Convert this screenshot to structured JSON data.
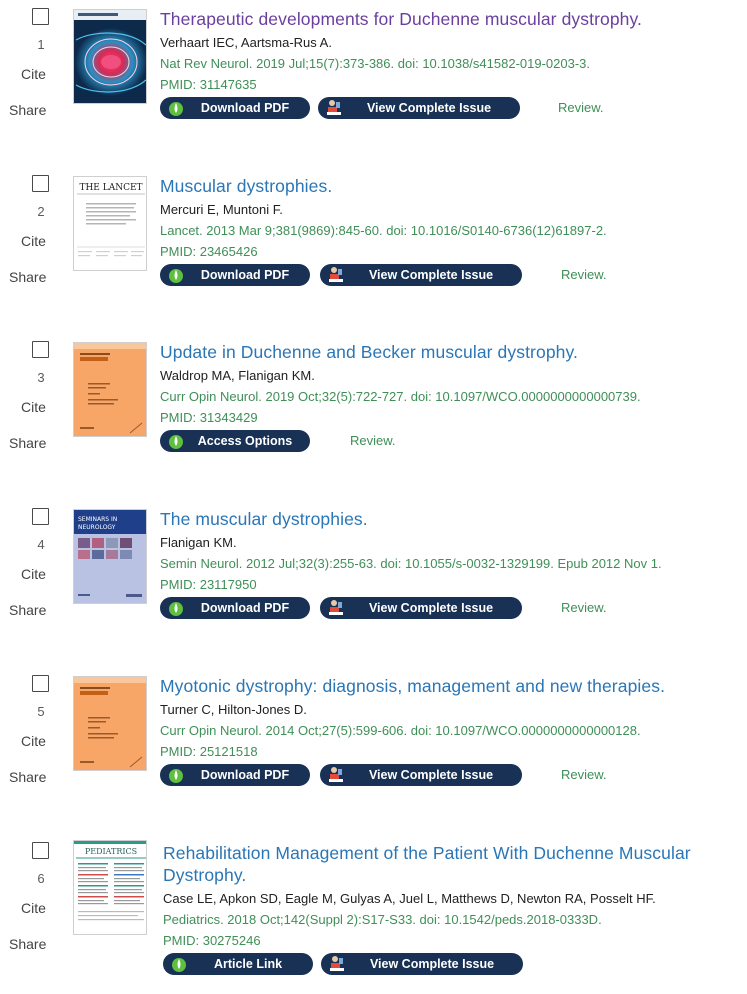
{
  "results": [
    {
      "number": "1",
      "title": "Therapeutic developments for Duchenne muscular dystrophy.",
      "authors": "Verhaart IEC, Aartsma-Rus A.",
      "citation": "Nat Rev Neurol. 2019 Jul;15(7):373-386. doi: 10.1038/s41582-019-0203-3.",
      "pmid": "PMID: 31147635",
      "buttons": [
        "Download PDF",
        "View Complete Issue"
      ],
      "tag": "Review.",
      "journal_cover": "nature reviews neurology"
    },
    {
      "number": "2",
      "title": "Muscular dystrophies.",
      "authors": "Mercuri E, Muntoni F.",
      "citation": "Lancet. 2013 Mar 9;381(9869):845-60. doi: 10.1016/S0140-6736(12)61897-2.",
      "pmid": "PMID: 23465426",
      "buttons": [
        "Download PDF",
        "View Complete Issue"
      ],
      "tag": "Review.",
      "journal_cover": "THE LANCET"
    },
    {
      "number": "3",
      "title": "Update in Duchenne and Becker muscular dystrophy.",
      "authors": "Waldrop MA, Flanigan KM.",
      "citation": "Curr Opin Neurol. 2019 Oct;32(5):722-727. doi: 10.1097/WCO.0000000000000739.",
      "pmid": "PMID: 31343429",
      "buttons": [
        "Access Options"
      ],
      "tag": "Review.",
      "journal_cover": "Current Opinion in Neurology"
    },
    {
      "number": "4",
      "title": "The muscular dystrophies.",
      "authors": "Flanigan KM.",
      "citation": "Semin Neurol. 2012 Jul;32(3):255-63. doi: 10.1055/s-0032-1329199. Epub 2012 Nov 1.",
      "pmid": "PMID: 23117950",
      "buttons": [
        "Download PDF",
        "View Complete Issue"
      ],
      "tag": "Review.",
      "journal_cover": "SEMINARS IN NEUROLOGY"
    },
    {
      "number": "5",
      "title": "Myotonic dystrophy: diagnosis, management and new therapies.",
      "authors": "Turner C, Hilton-Jones D.",
      "citation": "Curr Opin Neurol. 2014 Oct;27(5):599-606. doi: 10.1097/WCO.0000000000000128.",
      "pmid": "PMID: 25121518",
      "buttons": [
        "Download PDF",
        "View Complete Issue"
      ],
      "tag": "Review.",
      "journal_cover": "Current Opinion in Neurology"
    },
    {
      "number": "6",
      "title_line1": "Rehabilitation Management of the Patient With Duchenne Muscular",
      "title_line2": "Dystrophy.",
      "authors": "Case LE, Apkon SD, Eagle M, Gulyas A, Juel L, Matthews D, Newton RA, Posselt HF.",
      "citation": "Pediatrics. 2018 Oct;142(Suppl 2):S17-S33. doi: 10.1542/peds.2018-0333D.",
      "pmid": "PMID: 30275246",
      "buttons": [
        "Article Link",
        "View Complete Issue"
      ],
      "journal_cover": "PEDIATRICS"
    }
  ],
  "labels": {
    "cite": "Cite",
    "share": "Share"
  },
  "colors": {
    "title_link": "#2a76b6",
    "title_visited": "#6a3f9e",
    "citation_green": "#3f8f57",
    "button_navy": "#183154"
  },
  "icons": {
    "pdf_button": "green-drop-icon",
    "issue_button": "issue-reader-icon",
    "checkbox": "checkbox-icon"
  }
}
